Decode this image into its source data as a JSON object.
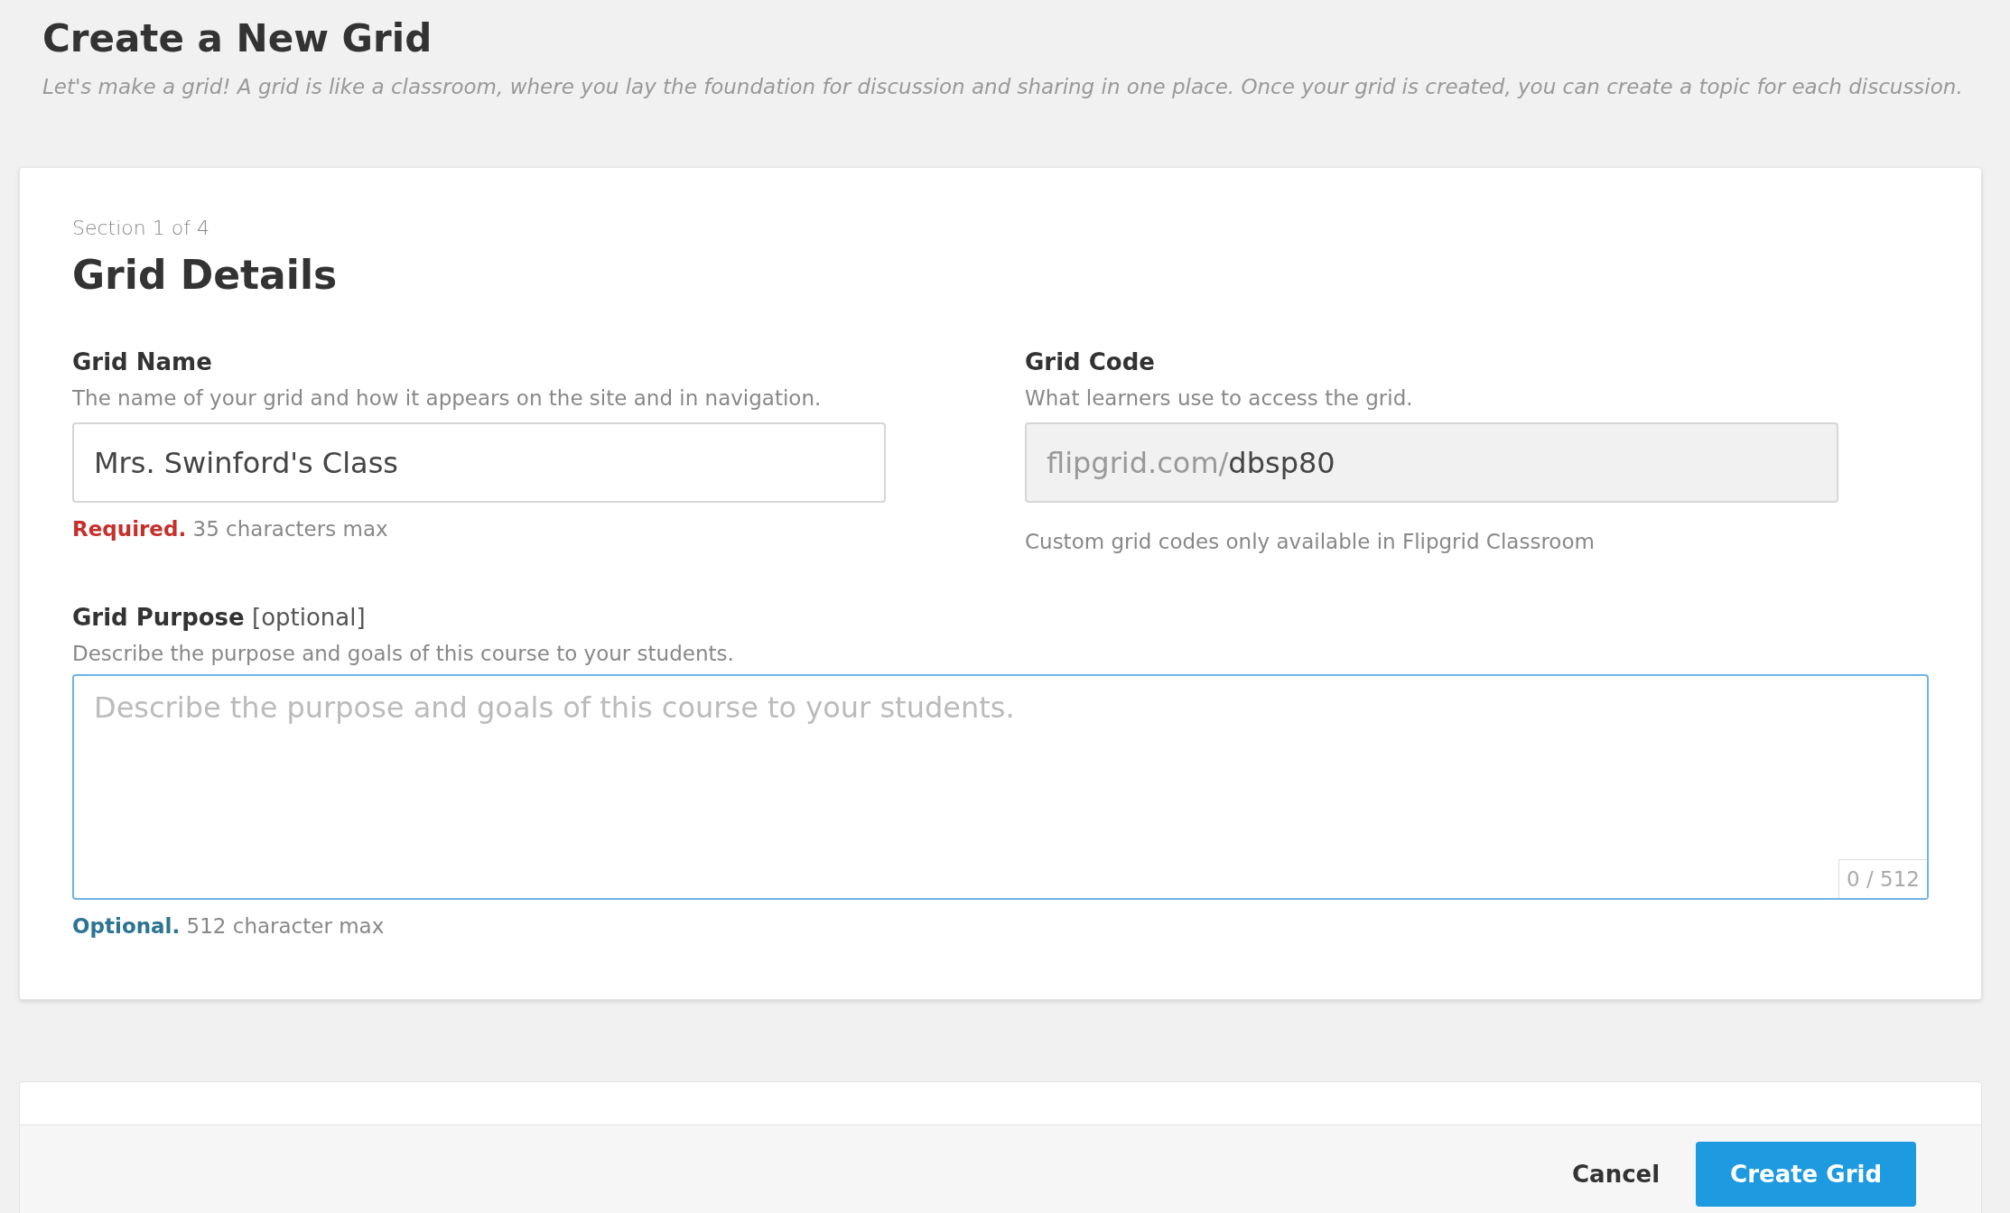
{
  "header": {
    "title": "Create a New Grid",
    "subtitle": "Let's make a grid! A grid is like a classroom, where you lay the foundation for discussion and sharing in one place. Once your grid is created, you can create a topic for each discussion."
  },
  "section": {
    "step": "Section 1 of 4",
    "title": "Grid Details",
    "fields": [
      {
        "label": "**Grid Name**",
        "hint": "The name of your grid and how it appears on the site and in navigation.",
        "value": "Mrs. Swinford's Class",
        "disabled": false,
        "note": "**Required.** 35 characters max",
        "kind": "required"
      },
      {
        "label": "**Grid Code**",
        "hint": "What learners use to access the grid.",
        "prefix": "flipgrid.com/",
        "value": "dbsp80",
        "disabled": true,
        "note": "Custom grid codes only available in Flipgrid Classroom",
        "kind": "info"
      }
    ],
    "purpose": {
      "label": "**Grid Purpose** [optional]",
      "hint": "Describe the purpose and goals of this course to your students.",
      "placeholder": "Describe the purpose and goals of this course to your students.",
      "focused": true,
      "counter": "0 / 512",
      "note": "**Optional.** 512 character max",
      "kind": "optional"
    }
  },
  "footer": {
    "buttons": [
      {
        "label": "Cancel",
        "kind": "secondary"
      },
      {
        "label": "Create Grid",
        "kind": "primary"
      }
    ]
  }
}
